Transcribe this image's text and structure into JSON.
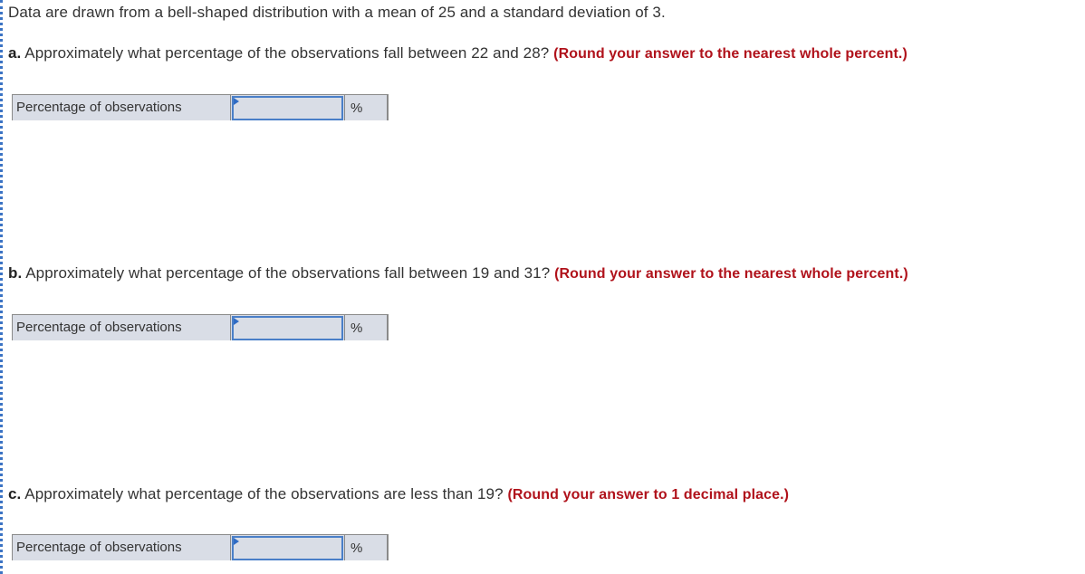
{
  "problem": {
    "intro": "Data are drawn from a bell-shaped distribution with a mean of 25 and a standard deviation of 3."
  },
  "questions": [
    {
      "letter": "a.",
      "text": " Approximately what percentage of the observations fall between 22 and 28? ",
      "instruction": "(Round your answer to the nearest whole percent.)",
      "answer_label": "Percentage of observations",
      "answer_value": "",
      "unit": "%"
    },
    {
      "letter": "b.",
      "text": " Approximately what percentage of the observations fall between 19 and 31? ",
      "instruction": "(Round your answer to the nearest whole percent.)",
      "answer_label": "Percentage of observations",
      "answer_value": "",
      "unit": "%"
    },
    {
      "letter": "c.",
      "text": " Approximately what percentage of the observations are less than 19? ",
      "instruction": "(Round your answer to 1 decimal place.)",
      "answer_label": "Percentage of observations",
      "answer_value": "",
      "unit": "%"
    }
  ],
  "colors": {
    "instruction_red": "#b0121b",
    "input_border_blue": "#4a7fc8",
    "answer_row_bg": "#d9dde6"
  }
}
